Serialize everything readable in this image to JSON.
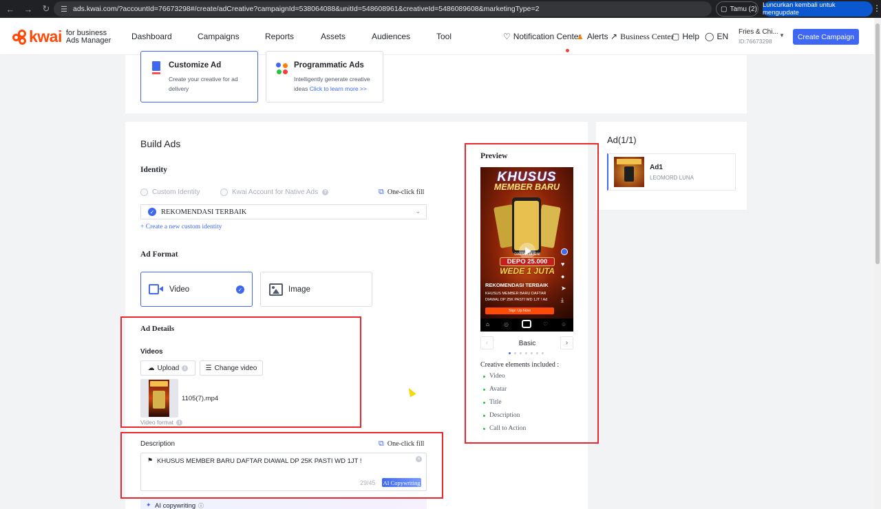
{
  "browser": {
    "url": "ads.kwai.com/?accountId=76673298#/create/adCreative?campaignId=538064088&unitId=548608961&creativeId=5486089608&marketingType=2",
    "profile_label": "Tamu (2)",
    "update_label": "Luncurkan kembali untuk mengupdate"
  },
  "brand": {
    "logo_text": "kwai",
    "sub_line1": "for business",
    "sub_line2": "Ads Manager"
  },
  "nav": {
    "items": [
      "Dashboard",
      "Campaigns",
      "Reports",
      "Assets",
      "Audiences",
      "Tool"
    ],
    "notification_center": "Notification Center",
    "alerts": "Alerts",
    "business_center": "Business Center",
    "help": "Help",
    "language": "EN",
    "account_name": "Fries & Chi...",
    "account_id": "ID:76673298",
    "create_campaign": "Create Campaign"
  },
  "creative_types": [
    {
      "title": "Customize Ad",
      "desc": "Create your creative for ad delivery"
    },
    {
      "title": "Programmatic Ads",
      "desc": "Intelligently generate creative ideas ",
      "link": "Click to learn more >>"
    }
  ],
  "build_ads": {
    "title": "Build Ads",
    "identity": {
      "label": "Identity",
      "option_custom": "Custom Identity",
      "option_kwai": "Kwai Account for Native Ads",
      "one_click_fill": "One-click fill",
      "selected_identity": "REKOMENDASI TERBAIK",
      "create_link": "+ Create a new custom identity"
    },
    "ad_format": {
      "label": "Ad Format",
      "video": "Video",
      "image": "Image"
    },
    "ad_details": {
      "label": "Ad Details",
      "videos_label": "Videos",
      "upload": "Upload",
      "change_video": "Change video",
      "file_name": "1105(7).mp4",
      "video_format": "Video format"
    },
    "description": {
      "label": "Description",
      "one_click_fill": "One-click fill",
      "text": "KHUSUS MEMBER BARU DAFTAR DIAWAL DP 25K PASTI WD 1JT !",
      "counter": "29/45",
      "ai_badge": "AI Copywriting",
      "ai_row_label": "AI copywriting"
    }
  },
  "preview": {
    "title": "Preview",
    "creative_top": "KHUSUS",
    "creative_sub": "MEMBER BARU",
    "creative_deposit": "DEPO 25.000",
    "creative_wd": "WEDE 1 JUTA",
    "creative_daftar": "DAFTAR DI SINI",
    "overlay_name": "REKOMENDASI TERBAIK",
    "overlay_desc": "KHUSUS MEMBER BARU DAFTAR DIAWAL DP 25K PASTI WD 1JT ! Ad",
    "cta": "Sign Up Now",
    "carousel_label": "Basic",
    "elements_title": "Creative elements included :",
    "elements": [
      "Video",
      "Avatar",
      "Title",
      "Description",
      "Call to Action"
    ]
  },
  "ad_list": {
    "title": "Ad(1/1)",
    "items": [
      {
        "name": "Ad1",
        "sub": "LEOMORD LUNA"
      }
    ]
  },
  "colors": {
    "primary": "#3e68f3",
    "kwai_orange": "#ff4906",
    "highlight_red": "#e8262b"
  }
}
